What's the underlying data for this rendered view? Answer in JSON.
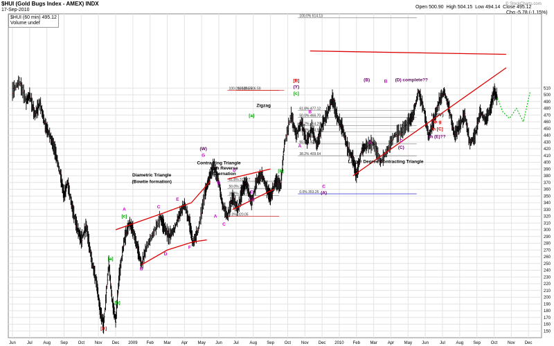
{
  "header": {
    "symbol": "$HUI",
    "name": "(Gold Bugs Index - AMEX)",
    "exchange": "INDX",
    "date": "17-Sep-2010",
    "series_label": "$HUI (60 min) 495.12",
    "volume_label": "Volume undef",
    "watermark": "© StockCharts.com",
    "quote": {
      "open_label": "Open",
      "open": "500.90",
      "high_label": "High",
      "high": "504.15",
      "low_label": "Low",
      "low": "494.14",
      "close_label": "Close",
      "close": "495.12",
      "chg_label": "Chg",
      "chg": "-5.78 (-1.15%)"
    }
  },
  "chart_data": {
    "type": "line",
    "title": "$HUI (Gold Bugs Index - AMEX) INDX",
    "xlabel": "",
    "ylabel": "",
    "ylim": [
      140,
      620
    ],
    "grid": true,
    "y_ticks": [
      150,
      160,
      170,
      180,
      190,
      200,
      210,
      220,
      230,
      240,
      250,
      260,
      270,
      280,
      290,
      300,
      310,
      320,
      330,
      340,
      350,
      360,
      370,
      380,
      390,
      400,
      410,
      420,
      430,
      440,
      450,
      460,
      470,
      480,
      490,
      500,
      510
    ],
    "x_ticks": [
      "Jun",
      "Jul",
      "Aug",
      "Sep",
      "Oct",
      "Nov",
      "Dec",
      "2009",
      "Feb",
      "Mar",
      "Apr",
      "May",
      "Jun",
      "Jul",
      "Aug",
      "Sep",
      "Oct",
      "Nov",
      "Dec",
      "2010",
      "Feb",
      "Mar",
      "Apr",
      "May",
      "Jun",
      "Jul",
      "Aug",
      "Sep",
      "Oct",
      "Nov",
      "Dec"
    ],
    "series": [
      {
        "values": [
          [
            0,
            505
          ],
          [
            0.4,
            520
          ],
          [
            0.8,
            490
          ],
          [
            1.0,
            500
          ],
          [
            1.3,
            470
          ],
          [
            1.6,
            488
          ],
          [
            1.9,
            455
          ],
          [
            2.2,
            438
          ],
          [
            2.5,
            415
          ],
          [
            2.8,
            380
          ],
          [
            3.0,
            350
          ],
          [
            3.2,
            370
          ],
          [
            3.5,
            330
          ],
          [
            3.8,
            300
          ],
          [
            4.0,
            285
          ],
          [
            4.3,
            305
          ],
          [
            4.6,
            255
          ],
          [
            4.9,
            220
          ],
          [
            5.1,
            180
          ],
          [
            5.3,
            158
          ],
          [
            5.6,
            250
          ],
          [
            5.8,
            195
          ],
          [
            6.0,
            165
          ],
          [
            6.2,
            230
          ],
          [
            6.5,
            285
          ],
          [
            6.8,
            310
          ],
          [
            7.0,
            300
          ],
          [
            7.3,
            270
          ],
          [
            7.5,
            248
          ],
          [
            7.8,
            275
          ],
          [
            8.2,
            295
          ],
          [
            8.6,
            318
          ],
          [
            8.8,
            305
          ],
          [
            9.1,
            290
          ],
          [
            9.4,
            300
          ],
          [
            9.7,
            322
          ],
          [
            10.0,
            338
          ],
          [
            10.3,
            310
          ],
          [
            10.5,
            280
          ],
          [
            10.8,
            300
          ],
          [
            11.2,
            355
          ],
          [
            11.4,
            373
          ],
          [
            11.7,
            395
          ],
          [
            12.0,
            370
          ],
          [
            12.2,
            338
          ],
          [
            12.5,
            320
          ],
          [
            12.8,
            348
          ],
          [
            13.1,
            330
          ],
          [
            13.4,
            362
          ],
          [
            13.6,
            370
          ],
          [
            13.9,
            340
          ],
          [
            14.2,
            372
          ],
          [
            14.5,
            382
          ],
          [
            14.8,
            360
          ],
          [
            15.0,
            348
          ],
          [
            15.3,
            372
          ],
          [
            15.6,
            365
          ],
          [
            15.8,
            425
          ],
          [
            16.2,
            470
          ],
          [
            16.5,
            440
          ],
          [
            16.8,
            460
          ],
          [
            17.1,
            430
          ],
          [
            17.4,
            450
          ],
          [
            17.7,
            425
          ],
          [
            18.0,
            455
          ],
          [
            18.3,
            472
          ],
          [
            18.6,
            495
          ],
          [
            18.9,
            465
          ],
          [
            19.2,
            450
          ],
          [
            19.5,
            420
          ],
          [
            19.8,
            405
          ],
          [
            20.0,
            380
          ],
          [
            20.3,
            418
          ],
          [
            20.6,
            425
          ],
          [
            21.0,
            428
          ],
          [
            21.4,
            400
          ],
          [
            21.8,
            418
          ],
          [
            22.2,
            440
          ],
          [
            22.6,
            445
          ],
          [
            23.0,
            458
          ],
          [
            23.3,
            470
          ],
          [
            23.6,
            505
          ],
          [
            23.9,
            480
          ],
          [
            24.2,
            438
          ],
          [
            24.5,
            462
          ],
          [
            24.8,
            490
          ],
          [
            25.1,
            505
          ],
          [
            25.4,
            478
          ],
          [
            25.7,
            440
          ],
          [
            26.0,
            455
          ],
          [
            26.3,
            470
          ],
          [
            26.6,
            428
          ],
          [
            26.9,
            440
          ],
          [
            27.2,
            475
          ],
          [
            27.5,
            462
          ],
          [
            27.8,
            480
          ],
          [
            28.0,
            505
          ],
          [
            28.2,
            495
          ]
        ]
      }
    ],
    "trendlines": [
      {
        "name": "diametric-upper",
        "points": [
          [
            6.0,
            300
          ],
          [
            8.8,
            325
          ],
          [
            10.4,
            340
          ],
          [
            11.5,
            372
          ]
        ]
      },
      {
        "name": "diametric-lower",
        "points": [
          [
            7.5,
            248
          ],
          [
            9.0,
            270
          ],
          [
            10.5,
            282
          ],
          [
            11.3,
            285
          ]
        ]
      },
      {
        "name": "ct-upper",
        "points": [
          [
            12.5,
            375
          ],
          [
            15.0,
            390
          ]
        ]
      },
      {
        "name": "ct-lower",
        "points": [
          [
            12.8,
            330
          ],
          [
            15.2,
            360
          ]
        ]
      },
      {
        "name": "large-upper",
        "points": [
          [
            17.3,
            565
          ],
          [
            28.7,
            560
          ]
        ]
      },
      {
        "name": "large-lower",
        "points": [
          [
            19.8,
            380
          ],
          [
            28.7,
            540
          ]
        ]
      }
    ],
    "projection": [
      [
        28.2,
        495
      ],
      [
        28.5,
        475
      ],
      [
        28.9,
        465
      ],
      [
        29.3,
        480
      ],
      [
        29.7,
        460
      ],
      [
        30.1,
        505
      ]
    ],
    "fib_levels": [
      {
        "label": "100.0%",
        "value": 506.59
      },
      {
        "label": "0.0%",
        "value": 320.05
      },
      {
        "label": "61.8%",
        "value": 371.77
      },
      {
        "label": "50.0%",
        "value": 361.31
      },
      {
        "label": "38.2%",
        "value": 350.85
      },
      {
        "label": "100.0%",
        "value": 614.13
      },
      {
        "label": "61.8%",
        "value": 477.12
      },
      {
        "label": "50.0%",
        "value": 466.7
      },
      {
        "label": "38.2%",
        "value": 454.29
      },
      {
        "label": "61.8%",
        "value": 444.95
      },
      {
        "label": "50.0%",
        "value": 427.33
      },
      {
        "label": "38.2%",
        "value": 409.64
      },
      {
        "label": "0.0%",
        "value": 353.25
      },
      {
        "label": "100.0%",
        "value": 506.59
      }
    ],
    "annotations": [
      {
        "text": "[A]",
        "x": 5.3,
        "y": 152,
        "color": "#cc0000"
      },
      {
        "text": "[a]",
        "x": 5.7,
        "y": 255,
        "color": "#009900"
      },
      {
        "text": "[b]",
        "x": 6.1,
        "y": 190,
        "color": "#009900"
      },
      {
        "text": "[c]",
        "x": 6.5,
        "y": 318,
        "color": "#009900"
      },
      {
        "text": "A",
        "x": 6.5,
        "y": 328,
        "color": "#cc00cc"
      },
      {
        "text": "B",
        "x": 7.5,
        "y": 240,
        "color": "#cc00cc"
      },
      {
        "text": "C",
        "x": 8.5,
        "y": 332,
        "color": "#cc00cc"
      },
      {
        "text": "D",
        "x": 8.9,
        "y": 262,
        "color": "#cc00cc"
      },
      {
        "text": "E",
        "x": 9.6,
        "y": 343,
        "color": "#cc00cc"
      },
      {
        "text": "F",
        "x": 10.3,
        "y": 272,
        "color": "#cc00cc"
      },
      {
        "text": "Diametric Triangle",
        "x": 8.1,
        "y": 379,
        "color": "#000000"
      },
      {
        "text": "(Bowtie formation)",
        "x": 8.1,
        "y": 369,
        "color": "#000000"
      },
      {
        "text": "(W)",
        "x": 11.1,
        "y": 418,
        "color": "#660066"
      },
      {
        "text": "G",
        "x": 11.1,
        "y": 408,
        "color": "#cc00cc"
      },
      {
        "text": "Contracting Triangle",
        "x": 12.0,
        "y": 397,
        "color": "#000000"
      },
      {
        "text": "with Reverse",
        "x": 12.3,
        "y": 389,
        "color": "#000000"
      },
      {
        "text": "Alternation",
        "x": 12.3,
        "y": 381,
        "color": "#000000"
      },
      {
        "text": "A",
        "x": 11.8,
        "y": 318,
        "color": "#cc00cc"
      },
      {
        "text": "B",
        "x": 12.0,
        "y": 367,
        "color": "#cc00cc"
      },
      {
        "text": "C",
        "x": 12.3,
        "y": 306,
        "color": "#cc00cc"
      },
      {
        "text": "D",
        "x": 12.9,
        "y": 386,
        "color": "#cc00cc"
      },
      {
        "text": "E",
        "x": 13.9,
        "y": 354,
        "color": "#cc00cc"
      },
      {
        "text": "(X)",
        "x": 13.9,
        "y": 343,
        "color": "#660066"
      },
      {
        "text": "[a]",
        "x": 13.9,
        "y": 467,
        "color": "#009900"
      },
      {
        "text": "[b]",
        "x": 15.6,
        "y": 385,
        "color": "#009900"
      },
      {
        "text": "Zigzag",
        "x": 14.6,
        "y": 482,
        "color": "#000000"
      },
      {
        "text": "[c]",
        "x": 16.5,
        "y": 500,
        "color": "#009900"
      },
      {
        "text": "(Y)",
        "x": 16.5,
        "y": 510,
        "color": "#660066"
      },
      {
        "text": "[B]",
        "x": 16.5,
        "y": 519,
        "color": "#cc0000"
      },
      {
        "text": "B",
        "x": 17.3,
        "y": 473,
        "color": "#cc00cc"
      },
      {
        "text": "A",
        "x": 16.7,
        "y": 422,
        "color": "#cc00cc"
      },
      {
        "text": "C",
        "x": 18.1,
        "y": 362,
        "color": "#cc00cc"
      },
      {
        "text": "(A)",
        "x": 18.1,
        "y": 353,
        "color": "#660066"
      },
      {
        "text": "(B)",
        "x": 20.6,
        "y": 520,
        "color": "#660066"
      },
      {
        "text": "A",
        "x": 20.8,
        "y": 427,
        "color": "#cc00cc"
      },
      {
        "text": "B",
        "x": 21.7,
        "y": 518,
        "color": "#cc00cc"
      },
      {
        "text": "C",
        "x": 22.6,
        "y": 430,
        "color": "#cc00cc"
      },
      {
        "text": "(C)",
        "x": 22.6,
        "y": 420,
        "color": "#660066"
      },
      {
        "text": "(D) complete??",
        "x": 23.2,
        "y": 520,
        "color": "#660066"
      },
      {
        "text": "In (IV)",
        "x": 24.7,
        "y": 468,
        "color": "#333333"
      },
      {
        "text": "In g",
        "x": 24.7,
        "y": 458,
        "color": "#cc0000"
      },
      {
        "text": "In [C]",
        "x": 24.7,
        "y": 447,
        "color": "#cc0000"
      },
      {
        "text": "In (E)??",
        "x": 24.7,
        "y": 436,
        "color": "#660066"
      },
      {
        "text": "Larger Degree Contracting Triangle",
        "x": 21.7,
        "y": 399,
        "color": "#000000"
      }
    ]
  }
}
